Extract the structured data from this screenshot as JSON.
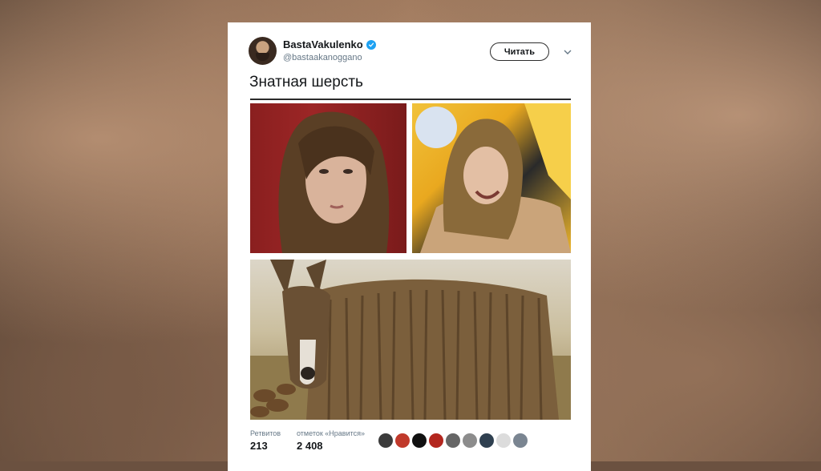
{
  "tweet": {
    "display_name": "BastaVakulenko",
    "handle": "@bastaakanoggano",
    "verified_icon": "verified-badge-icon",
    "follow_label": "Читать",
    "text": "Знатная шерсть",
    "media": [
      {
        "name": "photo-portrait-dreadlocks"
      },
      {
        "name": "photo-laughing-dreadlocks"
      },
      {
        "name": "photo-shaggy-donkey"
      }
    ],
    "stats": {
      "retweets_label": "Ретвитов",
      "retweets_value": "213",
      "likes_label": "отметок «Нравится»",
      "likes_value": "2 408"
    },
    "liker_avatars": [
      {
        "color": "#3b3b3b"
      },
      {
        "color": "#c0392b"
      },
      {
        "color": "#111111"
      },
      {
        "color": "#b3261e"
      },
      {
        "color": "#666666"
      },
      {
        "color": "#8c8c8c"
      },
      {
        "color": "#2f4050"
      },
      {
        "color": "#dcdcdc"
      },
      {
        "color": "#7a8591"
      }
    ]
  },
  "colors": {
    "accent": "#1da1f2",
    "text": "#14171a",
    "muted": "#657786"
  }
}
